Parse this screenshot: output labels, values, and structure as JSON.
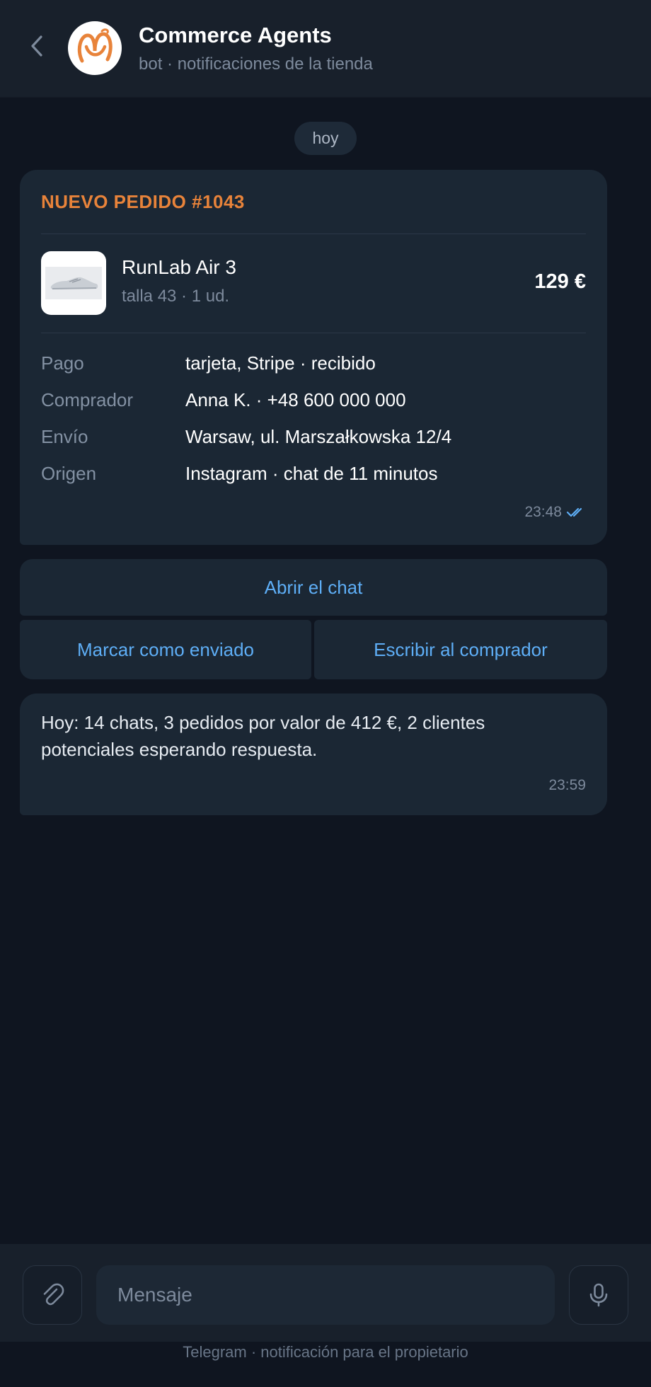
{
  "header": {
    "back_icon": "chevron-left-icon",
    "title": "Commerce Agents",
    "subtitle": "bot · notificaciones de la tienda",
    "avatar_icon": "commerce-agents-logo",
    "accent_color": "#e8833a"
  },
  "chat": {
    "date_label": "hoy",
    "order_message": {
      "title": "NUEVO PEDIDO #1043",
      "product": {
        "image_icon": "sneaker-image",
        "name": "RunLab Air 3",
        "variant": "talla 43 · 1 ud.",
        "price": "129 €"
      },
      "details": [
        {
          "label": "Pago",
          "value": "tarjeta, Stripe · recibido"
        },
        {
          "label": "Comprador",
          "value": "Anna K. · +48 600 000 000"
        },
        {
          "label": "Envío",
          "value": "Warsaw, ul. Marszałkowska 12/4"
        },
        {
          "label": "Origen",
          "value": "Instagram · chat de 11 minutos"
        }
      ],
      "time": "23:48",
      "status_icon": "double-check-icon"
    },
    "buttons": {
      "open_chat": "Abrir el chat",
      "mark_shipped": "Marcar como enviado",
      "write_buyer": "Escribir al comprador"
    },
    "summary_message": {
      "text": "Hoy: 14 chats, 3 pedidos por valor de 412 €, 2 clientes potenciales esperando respuesta.",
      "time": "23:59"
    }
  },
  "composer": {
    "attach_icon": "paperclip-icon",
    "placeholder": "Mensaje",
    "mic_icon": "microphone-icon"
  },
  "footer": {
    "note": "Telegram · notificación para el propietario"
  },
  "colors": {
    "background": "#0f1520",
    "bubble": "#1b2734",
    "link": "#5eaef6",
    "muted": "#7d8a9c"
  }
}
